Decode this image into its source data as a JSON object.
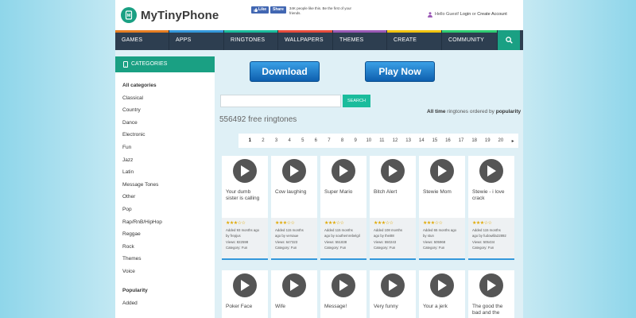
{
  "header": {
    "logo_letter": "M",
    "logo_text": "MyTinyPhone",
    "fb_like": "Like",
    "fb_share": "Share",
    "fb_text": "34K people like this. Be the first of your friends.",
    "account_greeting": "Hello Guest!",
    "login_label": "Login",
    "or_label": "or",
    "create_account_label": "Create Account"
  },
  "nav": {
    "items": [
      "GAMES",
      "APPS",
      "RINGTONES",
      "WALLPAPERS",
      "THEMES",
      "CREATE",
      "COMMUNITY"
    ]
  },
  "sidebar": {
    "header_label": "CATEGORIES",
    "categories": [
      "All categories",
      "Classical",
      "Country",
      "Dance",
      "Electronic",
      "Fun",
      "Jazz",
      "Latin",
      "Message Tones",
      "Other",
      "Pop",
      "Rap/RnB/HipHop",
      "Reggae",
      "Rock",
      "Themes",
      "Voice"
    ],
    "popularity_title": "Popularity",
    "popularity_items": [
      "Added"
    ]
  },
  "buttons": {
    "download_label": "Download",
    "play_now_label": "Play Now"
  },
  "search": {
    "placeholder": "",
    "button_label": "SEARCH"
  },
  "listing": {
    "order_prefix": "All time",
    "order_middle": "ringtones ordered by",
    "order_suffix": "popularity",
    "count_text": "556492 free ringtones"
  },
  "pagination": {
    "pages": [
      "1",
      "2",
      "3",
      "4",
      "5",
      "6",
      "7",
      "8",
      "9",
      "10",
      "11",
      "12",
      "13",
      "14",
      "15",
      "16",
      "17",
      "18",
      "19",
      "20"
    ],
    "active": "1",
    "next": "▸"
  },
  "ringtones_row1": [
    {
      "title": "Your dumb sister is calling",
      "stars": "★★★☆☆",
      "added": "Added 93 months ago",
      "by": "by frepjus",
      "views": "Views: 822598",
      "category": "Category: Fun"
    },
    {
      "title": "Cow laughing",
      "stars": "★★★☆☆",
      "added": "Added 115 months",
      "by": "ago by versaue",
      "views": "Views: 647323",
      "category": "Category: Fun"
    },
    {
      "title": "Super Mario",
      "stars": "★★★☆☆",
      "added": "Added 115 months",
      "by": "ago by southernrebelgil",
      "views": "Views: 551838",
      "category": "Category: Fun"
    },
    {
      "title": "Bitch Alert",
      "stars": "★★★☆☆",
      "added": "Added 108 months",
      "by": "ago by thei88",
      "views": "Views: 550243",
      "category": "Category: Fun"
    },
    {
      "title": "Stewie Mom",
      "stars": "★★★☆☆",
      "added": "Added 65 months ago",
      "by": "by stun",
      "views": "Views: 505968",
      "category": "Category: Fun"
    },
    {
      "title": "Stewie - i love crack",
      "stars": "★★★☆☆",
      "added": "Added 115 months",
      "by": "ago by fudowilla22892",
      "views": "Views: 505434",
      "category": "Category: Fun"
    }
  ],
  "ringtones_row2": [
    {
      "title": "Poker Face"
    },
    {
      "title": "Wife"
    },
    {
      "title": "Message!"
    },
    {
      "title": "Very funny"
    },
    {
      "title": "Your a jerk"
    },
    {
      "title": "The good the bad and the"
    }
  ],
  "colors": {
    "accent": "#1aa083",
    "nav_bg": "#2d3e50",
    "download_blue": "#1e78c8",
    "star": "#e0a800"
  }
}
